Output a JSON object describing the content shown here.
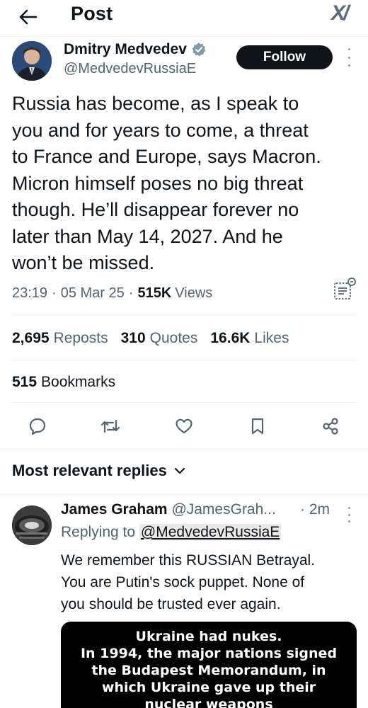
{
  "header": {
    "title": "Post",
    "logo_text": "X/"
  },
  "author": {
    "name": "Dmitry Medvedev",
    "handle": "@MedvedevRussiaE",
    "verified": true,
    "follow_label": "Follow"
  },
  "tweet": {
    "text": "Russia has become, as I speak to\nyou and for years to come, a threat\nto France and Europe, says Macron.\nMicron himself poses no big threat\nthough. He’ll disappear forever no\nlater than May 14, 2027. And he\nwon’t be missed.",
    "time": "23:19",
    "date": "05 Mar 25",
    "views_count": "515K",
    "views_label": "Views"
  },
  "stats": {
    "reposts_count": "2,695",
    "reposts_label": "Reposts",
    "quotes_count": "310",
    "quotes_label": "Quotes",
    "likes_count": "16.6K",
    "likes_label": "Likes",
    "bookmarks_count": "515",
    "bookmarks_label": "Bookmarks"
  },
  "actions": [
    "reply-icon",
    "repost-icon",
    "like-icon",
    "bookmark-icon",
    "share-icon"
  ],
  "replies": {
    "sort_label": "Most relevant replies",
    "items": [
      {
        "name": "James Graham",
        "handle": "@JamesGrah...",
        "time": "· 2m",
        "replying_prefix": "Replying to",
        "replying_to": "@MedvedevRussiaE",
        "text": "We remember this RUSSIAN Betrayal.\nYou are Putin's sock puppet. None of\nyou should be trusted ever again.",
        "media_lines": [
          "Ukraine had nukes.",
          "In 1994, the major nations signed",
          "the Budapest Memorandum, in",
          "which Ukraine gave up their",
          "nuclear weapons"
        ]
      }
    ]
  },
  "colors": {
    "text": "#0f1419",
    "secondary": "#536471",
    "divider": "#eff3f4",
    "verified": "#829aab",
    "follow_bg": "#0f1419"
  }
}
